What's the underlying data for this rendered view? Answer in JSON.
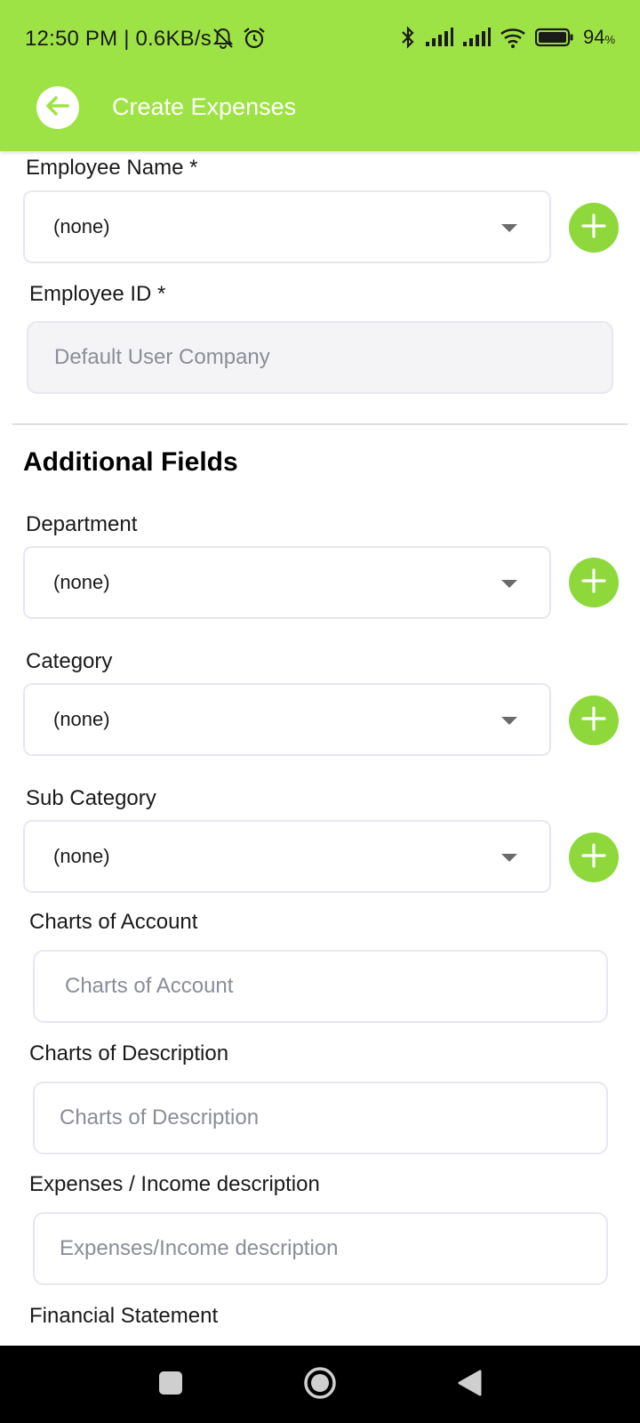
{
  "status_bar": {
    "time": "12:50 PM | 0.6KB/s",
    "battery": "94",
    "battery_unit": "%",
    "icons": [
      "bell-off-icon",
      "alarm-icon",
      "bluetooth-icon",
      "signal-icon",
      "signal-icon",
      "wifi-icon",
      "battery-icon"
    ]
  },
  "app_bar": {
    "title": "Create Expenses",
    "back_icon": "back-arrow-icon",
    "accent_color": "#9ee345"
  },
  "form": {
    "employee_name": {
      "label": "Employee Name *",
      "value": "(none)"
    },
    "employee_id": {
      "label": "Employee ID *",
      "placeholder": "Default User Company"
    },
    "section_title": "Additional Fields",
    "department": {
      "label": "Department",
      "value": "(none)"
    },
    "category": {
      "label": "Category",
      "value": "(none)"
    },
    "sub_category": {
      "label": "Sub Category",
      "value": "(none)"
    },
    "charts_of_account": {
      "label": "Charts of Account",
      "placeholder": "Charts of Account"
    },
    "charts_of_description": {
      "label": "Charts of Description",
      "placeholder": "Charts of Description"
    },
    "expenses_income_description": {
      "label": "Expenses / Income description",
      "placeholder": "Expenses/Income description"
    },
    "financial_statement": {
      "label": "Financial Statement"
    },
    "add_button_color": "#8ed83b"
  },
  "nav_bar": {
    "icons": [
      "recents-square-icon",
      "home-circle-icon",
      "back-triangle-icon"
    ]
  }
}
